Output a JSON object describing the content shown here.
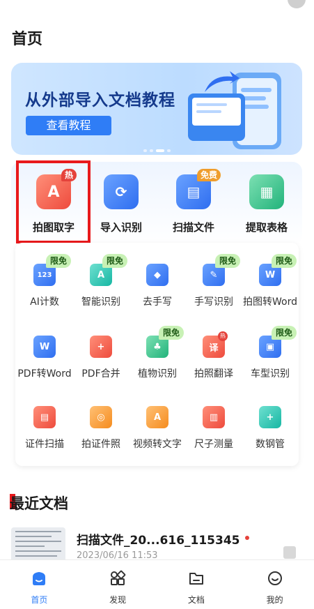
{
  "header": {
    "title": "首页"
  },
  "banner": {
    "title": "从外部导入文档教程",
    "button_label": "查看教程"
  },
  "top_tools": [
    {
      "label": "拍图取字",
      "badge": "热",
      "icon": "photo-text-icon",
      "color": "#ee4b3d"
    },
    {
      "label": "导入识别",
      "badge": "",
      "icon": "import-recognize-icon",
      "color": "#2f6ef0"
    },
    {
      "label": "扫描文件",
      "badge": "免费",
      "icon": "scan-file-icon",
      "color": "#2f6ef0"
    },
    {
      "label": "提取表格",
      "badge": "",
      "icon": "table-extract-icon",
      "color": "#22b37b"
    }
  ],
  "grid": {
    "tag_label": "限免",
    "hot_label": "热",
    "items": [
      {
        "label": "AI计数",
        "tag": true,
        "glyph": "123"
      },
      {
        "label": "智能识别",
        "tag": true,
        "glyph": "A"
      },
      {
        "label": "去手写",
        "tag": false,
        "glyph": "◆"
      },
      {
        "label": "手写识别",
        "tag": true,
        "glyph": "✎"
      },
      {
        "label": "拍图转Word",
        "tag": true,
        "glyph": "W"
      },
      {
        "label": "PDF转Word",
        "tag": false,
        "glyph": "W"
      },
      {
        "label": "PDF合并",
        "tag": false,
        "glyph": "+"
      },
      {
        "label": "植物识别",
        "tag": true,
        "glyph": "♣"
      },
      {
        "label": "拍照翻译",
        "tag": false,
        "glyph": "译"
      },
      {
        "label": "车型识别",
        "tag": true,
        "glyph": "▣"
      },
      {
        "label": "证件扫描",
        "tag": false,
        "glyph": "▤"
      },
      {
        "label": "拍证件照",
        "tag": false,
        "glyph": "◎"
      },
      {
        "label": "视频转文字",
        "tag": false,
        "glyph": "A"
      },
      {
        "label": "尺子测量",
        "tag": false,
        "glyph": "▥"
      },
      {
        "label": "数钢管",
        "tag": false,
        "glyph": "+"
      }
    ]
  },
  "recent": {
    "title": "最近文档",
    "doc_name": "扫描文件_20...616_115345",
    "doc_date": "2023/06/16 11:53"
  },
  "nav": [
    {
      "label": "首页",
      "icon": "home-icon",
      "active": true
    },
    {
      "label": "发现",
      "icon": "discover-icon",
      "active": false
    },
    {
      "label": "文档",
      "icon": "folder-icon",
      "active": false
    },
    {
      "label": "我的",
      "icon": "profile-icon",
      "active": false
    }
  ],
  "colors": {
    "accent": "#2f7df6",
    "highlight_box": "#e8191c",
    "free_tag": "#c8f1b5"
  }
}
